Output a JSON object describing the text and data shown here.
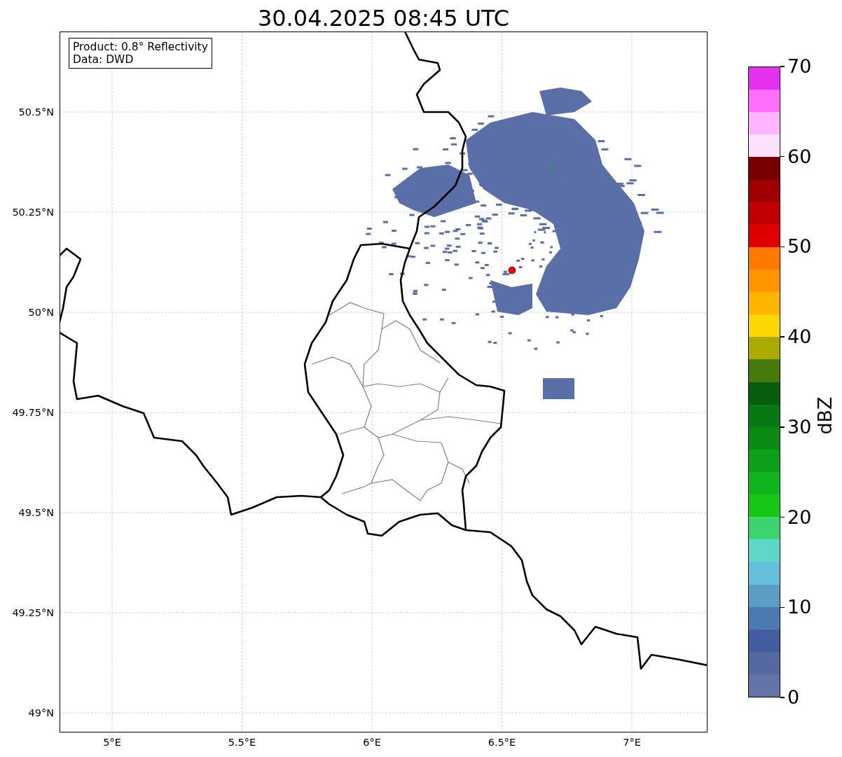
{
  "title": "30.04.2025 08:45 UTC",
  "legend": {
    "lines": [
      "Product: 0.8° Reflectivity",
      "Data: DWD"
    ]
  },
  "map": {
    "yticks": [
      "50.5°N",
      "50.25°N",
      "50°N",
      "49.75°N",
      "49.5°N",
      "49.25°N",
      "49°N"
    ],
    "xticks": [
      "5°E",
      "5.5°E",
      "6°E",
      "6.5°E",
      "7°E"
    ]
  },
  "colorbar": {
    "label": "dBZ",
    "ticks": [
      "70",
      "60",
      "50",
      "40",
      "30",
      "20",
      "10",
      "0"
    ],
    "segments": [
      {
        "color": "#e632f0"
      },
      {
        "color": "#ff6eff"
      },
      {
        "color": "#ffb4ff"
      },
      {
        "color": "#ffe0ff"
      },
      {
        "color": "#780000"
      },
      {
        "color": "#a00000"
      },
      {
        "color": "#c00000"
      },
      {
        "color": "#e00000"
      },
      {
        "color": "#ff7800"
      },
      {
        "color": "#ff9600"
      },
      {
        "color": "#ffb400"
      },
      {
        "color": "#ffd700"
      },
      {
        "color": "#aaac00"
      },
      {
        "color": "#467a0a"
      },
      {
        "color": "#065e0c"
      },
      {
        "color": "#087814"
      },
      {
        "color": "#0a8c14"
      },
      {
        "color": "#0ca018"
      },
      {
        "color": "#10b41c"
      },
      {
        "color": "#14c814"
      },
      {
        "color": "#3cd46e"
      },
      {
        "color": "#5ed6c8"
      },
      {
        "color": "#64c0dc"
      },
      {
        "color": "#5a9ec4"
      },
      {
        "color": "#4a7ab0"
      },
      {
        "color": "#425ea0"
      },
      {
        "color": "#5568a0"
      },
      {
        "color": "#6574a6"
      }
    ]
  }
}
